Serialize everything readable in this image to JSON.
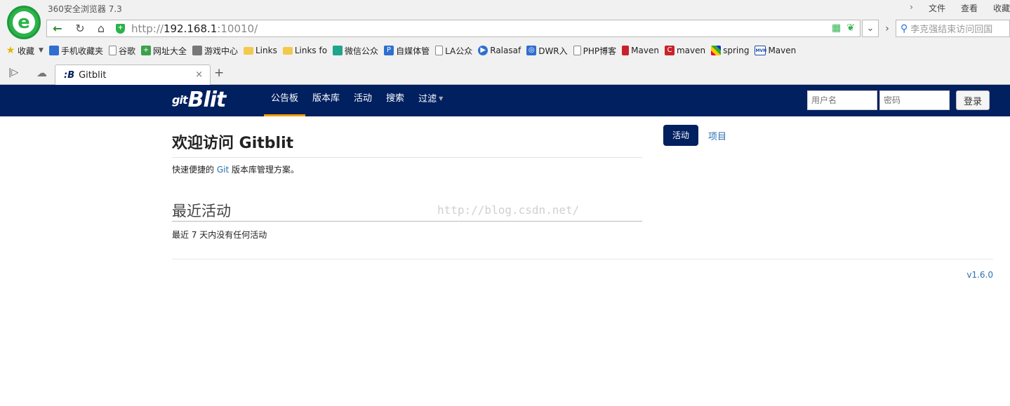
{
  "browser": {
    "title": "360安全浏览器 7.3",
    "menu": [
      "文件",
      "查看",
      "收藏"
    ],
    "url_scheme": "http://",
    "url_host": "192.168.1",
    "url_rest": ":10010/",
    "search_placeholder": "李克强结束访问回国"
  },
  "bookmarks": [
    {
      "label": "收藏",
      "icon": "star-icon"
    },
    {
      "label": "手机收藏夹",
      "icon": "phone-icon"
    },
    {
      "label": "谷歌",
      "icon": "page-icon"
    },
    {
      "label": "网址大全",
      "icon": "navigation-icon"
    },
    {
      "label": "游戏中心",
      "icon": "gamepad-icon"
    },
    {
      "label": "Links",
      "icon": "folder-icon"
    },
    {
      "label": "Links fo",
      "icon": "folder-icon"
    },
    {
      "label": "微信公众",
      "icon": "wechat-icon"
    },
    {
      "label": "自媒体管",
      "icon": "p-icon"
    },
    {
      "label": "LA公众",
      "icon": "page-icon"
    },
    {
      "label": "Ralasaf",
      "icon": "play-icon"
    },
    {
      "label": "DWR入",
      "icon": "dwr-icon"
    },
    {
      "label": "PHP博客",
      "icon": "page-icon"
    },
    {
      "label": "Maven",
      "icon": "book-icon"
    },
    {
      "label": "maven",
      "icon": "c-icon"
    },
    {
      "label": "spring",
      "icon": "spring-icon"
    },
    {
      "label": "Maven",
      "icon": "mvn-icon"
    }
  ],
  "tab": {
    "title": "Gitblit",
    "close": "×",
    "new": "+"
  },
  "gitblit": {
    "brand_git": "git",
    "brand_blit": "Blit",
    "nav": [
      "公告板",
      "版本库",
      "活动",
      "搜索",
      "过滤"
    ],
    "username_placeholder": "用户名",
    "password_placeholder": "密码",
    "login_label": "登录",
    "welcome_title": "欢迎访问 Gitblit",
    "tagline_pre": "快速便捷的 ",
    "tagline_link": "Git",
    "tagline_post": " 版本库管理方案。",
    "recent_title": "最近活动",
    "recent_empty": "最近 7 天内没有任何活动",
    "pill_activity": "活动",
    "pill_projects": "项目",
    "version": "v1.6.0",
    "watermark": "http://blog.csdn.net/"
  },
  "colors": {
    "navbar": "#002060",
    "active_underline": "#f5a000",
    "link": "#2a6fb0",
    "browser_green": "#2bb34a"
  }
}
